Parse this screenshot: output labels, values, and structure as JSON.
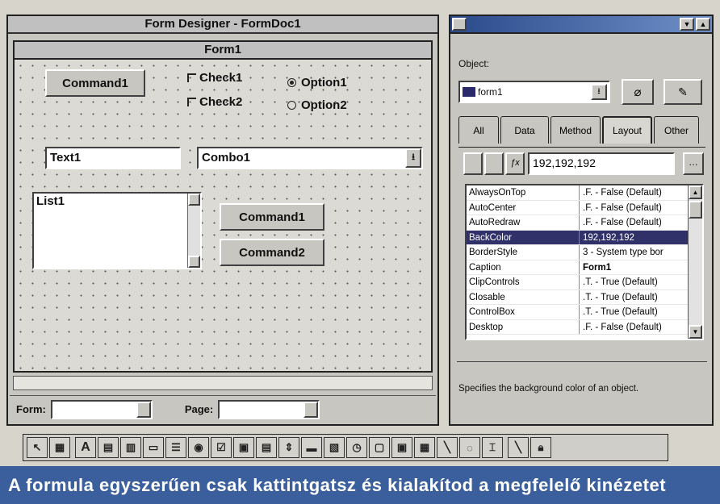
{
  "form_designer": {
    "title": "Form Designer - FormDoc1",
    "form_title": "Form1",
    "command1": "Command1",
    "check1": "Check1",
    "check2": "Check2",
    "option1": "Option1",
    "option2": "Option2",
    "text1": "Text1",
    "combo1": "Combo1",
    "list1": "List1",
    "command1b": "Command1",
    "command2": "Command2",
    "status_form_label": "Form:",
    "status_page_label": "Page:"
  },
  "properties": {
    "object_label": "Object:",
    "object_value": "form1",
    "tabs": [
      "All",
      "Data",
      "Method",
      "Layout",
      "Other"
    ],
    "active_tab": "Layout",
    "edit_value": "192,192,192",
    "rows": [
      {
        "name": "AlwaysOnTop",
        "value": ".F. - False (Default)"
      },
      {
        "name": "AutoCenter",
        "value": ".F. - False (Default)"
      },
      {
        "name": "AutoRedraw",
        "value": ".F. - False (Default)"
      },
      {
        "name": "BackColor",
        "value": "192,192,192"
      },
      {
        "name": "BorderStyle",
        "value": "3 - System type bor"
      },
      {
        "name": "Caption",
        "value": "Form1"
      },
      {
        "name": "ClipControls",
        "value": ".T. - True (Default)"
      },
      {
        "name": "Closable",
        "value": ".T. - True (Default)"
      },
      {
        "name": "ControlBox",
        "value": ".T. - True (Default)"
      },
      {
        "name": "Desktop",
        "value": ".F. - False (Default)"
      }
    ],
    "selected_row": "BackColor",
    "description": "Specifies the background color of an object."
  },
  "caption": "A formula egyszerűen csak kattintgatsz és kialakítod a megfelelő kinézetet",
  "colors": {
    "selection": "#31316a",
    "caption_bg": "#3a5f9c"
  }
}
